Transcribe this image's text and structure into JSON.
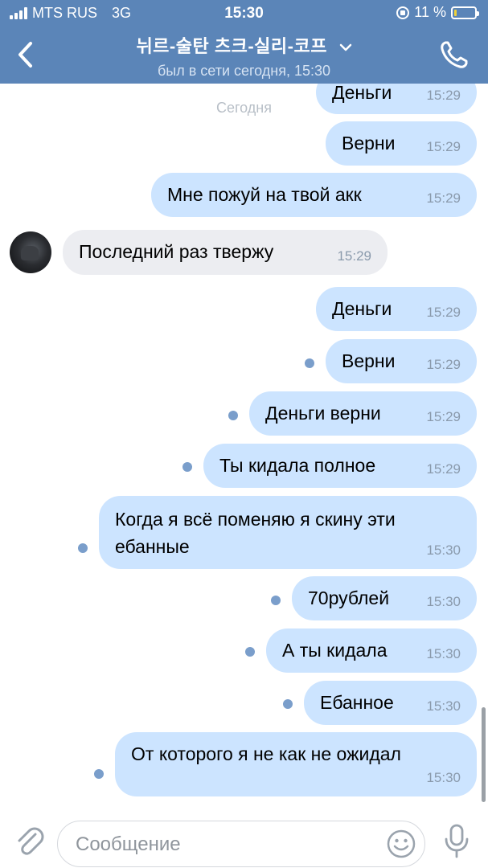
{
  "status_bar": {
    "carrier": "MTS RUS",
    "network": "3G",
    "time": "15:30",
    "battery_percent": "11 %",
    "battery_level": 0.11
  },
  "header": {
    "title": "뉘르-술탄 츠크-실리-코프",
    "subtitle": "был в сети сегодня, 15:30"
  },
  "chat": {
    "date_separator": "Сегодня",
    "messages": [
      {
        "dir": "out",
        "text": "Деньги",
        "time": "15:29"
      },
      {
        "dir": "out",
        "text": "Верни",
        "time": "15:29"
      },
      {
        "dir": "out",
        "text": "Мне пожуй на твой акк",
        "time": "15:29"
      },
      {
        "dir": "in",
        "text": "Последний раз твержу",
        "time": "15:29"
      },
      {
        "dir": "out",
        "text": "Деньги",
        "time": "15:29"
      },
      {
        "dir": "out",
        "text": "Верни",
        "time": "15:29",
        "unread": true
      },
      {
        "dir": "out",
        "text": "Деньги верни",
        "time": "15:29",
        "unread": true
      },
      {
        "dir": "out",
        "text": "Ты кидала полное",
        "time": "15:29",
        "unread": true
      },
      {
        "dir": "out",
        "text": "Когда я всё поменяю я скину эти ебанные",
        "time": "15:30",
        "unread": true
      },
      {
        "dir": "out",
        "text": "70рублей",
        "time": "15:30",
        "unread": true
      },
      {
        "dir": "out",
        "text": "А ты кидала",
        "time": "15:30",
        "unread": true
      },
      {
        "dir": "out",
        "text": "Ебанное",
        "time": "15:30",
        "unread": true
      },
      {
        "dir": "out",
        "text": "От которого я не как не ожидал",
        "time": "15:30",
        "unread": true
      }
    ]
  },
  "composer": {
    "placeholder": "Сообщение",
    "value": ""
  },
  "colors": {
    "header_bg": "#5b85b8",
    "outgoing_bubble": "#cce4ff",
    "incoming_bubble": "#ecedf1",
    "unread_dot": "#7a9ecb",
    "timestamp": "#8a9aac"
  },
  "icons": [
    "back-arrow-icon",
    "chevron-down-icon",
    "phone-icon",
    "paperclip-icon",
    "smile-icon",
    "microphone-icon",
    "lock-rotation-icon",
    "battery-icon",
    "signal-icon"
  ]
}
